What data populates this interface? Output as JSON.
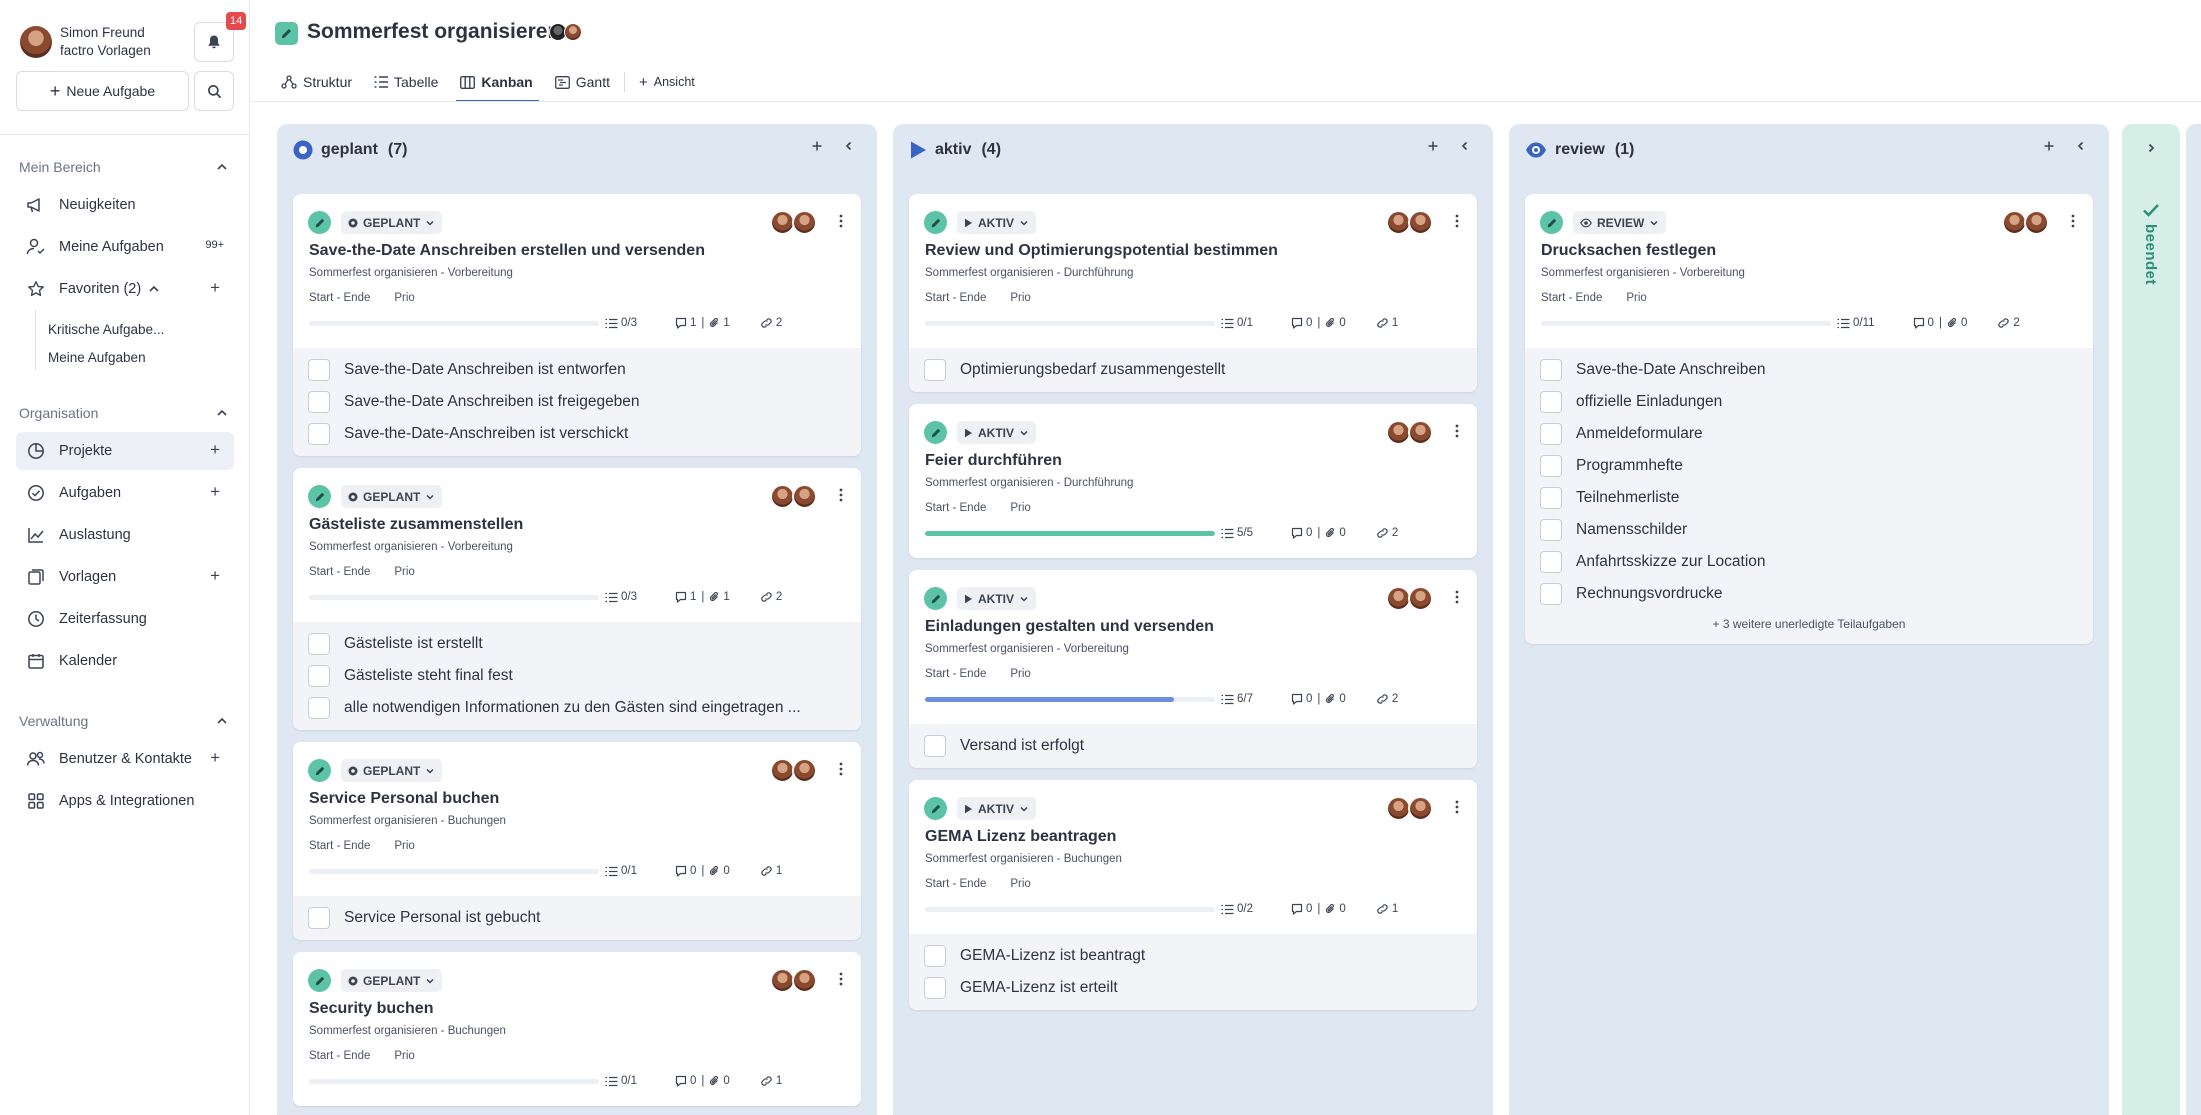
{
  "sidebar": {
    "user_name": "Simon Freund",
    "user_org": "factro Vorlagen",
    "notifications_count": "14",
    "new_task_label": "Neue Aufgabe",
    "sections": {
      "mein_bereich": "Mein Bereich",
      "organisation": "Organisation",
      "verwaltung": "Verwaltung"
    },
    "items": {
      "neuigkeiten": "Neuigkeiten",
      "meine_aufgaben": "Meine Aufgaben",
      "meine_aufgaben_badge": "99+",
      "favoriten": "Favoriten (2)",
      "fav_1": "Kritische Aufgabe...",
      "fav_2": "Meine Aufgaben",
      "projekte": "Projekte",
      "aufgaben": "Aufgaben",
      "auslastung": "Auslastung",
      "vorlagen": "Vorlagen",
      "zeiterfassung": "Zeiterfassung",
      "kalender": "Kalender",
      "benutzer": "Benutzer & Kontakte",
      "apps": "Apps & Integrationen"
    }
  },
  "header": {
    "title": "Sommerfest organisieren",
    "tabs": {
      "struktur": "Struktur",
      "tabelle": "Tabelle",
      "kanban": "Kanban",
      "gantt": "Gantt",
      "ansicht": "Ansicht"
    }
  },
  "colors": {
    "accent": "#3a63c6",
    "green": "#5cc3a7",
    "progress_green": "#5cc3a7",
    "progress_blue": "#6b8fdb",
    "column_bg": "#dfe7f3",
    "done_bg": "#d5efe6"
  },
  "columns": {
    "geplant": {
      "title": "geplant",
      "count": "(7)",
      "cards": [
        {
          "status": "GEPLANT",
          "title": "Save-the-Date Anschreiben erstellen und versenden",
          "subtitle": "Sommerfest organisieren - Vorbereitung",
          "dates": "Start - Ende",
          "prio": "Prio",
          "progress": 0,
          "checks": "0/3",
          "comments": "1",
          "attachments": "1",
          "links": "2",
          "subtasks": [
            "Save-the-Date Anschreiben ist entworfen",
            "Save-the-Date Anschreiben ist freigegeben",
            "Save-the-Date-Anschreiben ist verschickt"
          ]
        },
        {
          "status": "GEPLANT",
          "title": "Gästeliste zusammenstellen",
          "subtitle": "Sommerfest organisieren - Vorbereitung",
          "dates": "Start - Ende",
          "prio": "Prio",
          "progress": 0,
          "checks": "0/3",
          "comments": "1",
          "attachments": "1",
          "links": "2",
          "subtasks": [
            "Gästeliste ist erstellt",
            "Gästeliste steht final fest",
            "alle notwendigen Informationen zu den Gästen sind eingetragen ..."
          ]
        },
        {
          "status": "GEPLANT",
          "title": "Service Personal buchen",
          "subtitle": "Sommerfest organisieren - Buchungen",
          "dates": "Start - Ende",
          "prio": "Prio",
          "progress": 0,
          "checks": "0/1",
          "comments": "0",
          "attachments": "0",
          "links": "1",
          "subtasks": [
            "Service Personal ist gebucht"
          ]
        },
        {
          "status": "GEPLANT",
          "title": "Security buchen",
          "subtitle": "Sommerfest organisieren - Buchungen",
          "dates": "Start - Ende",
          "prio": "Prio",
          "progress": 0,
          "checks": "0/1",
          "comments": "0",
          "attachments": "0",
          "links": "1",
          "subtasks": []
        }
      ]
    },
    "aktiv": {
      "title": "aktiv",
      "count": "(4)",
      "cards": [
        {
          "status": "AKTIV",
          "title": "Review und Optimierungspotential bestimmen",
          "subtitle": "Sommerfest organisieren - Durchführung",
          "dates": "Start - Ende",
          "prio": "Prio",
          "progress": 0,
          "checks": "0/1",
          "comments": "0",
          "attachments": "0",
          "links": "1",
          "subtasks": [
            "Optimierungsbedarf zusammengestellt"
          ]
        },
        {
          "status": "AKTIV",
          "title": "Feier durchführen",
          "subtitle": "Sommerfest organisieren - Durchführung",
          "dates": "Start - Ende",
          "prio": "Prio",
          "progress": 1,
          "checks": "5/5",
          "comments": "0",
          "attachments": "0",
          "links": "2",
          "subtasks": []
        },
        {
          "status": "AKTIV",
          "title": "Einladungen gestalten und versenden",
          "subtitle": "Sommerfest organisieren - Vorbereitung",
          "dates": "Start - Ende",
          "prio": "Prio",
          "progress": 0.857,
          "checks": "6/7",
          "comments": "0",
          "attachments": "0",
          "links": "2",
          "subtasks": [
            "Versand ist erfolgt"
          ]
        },
        {
          "status": "AKTIV",
          "title": "GEMA Lizenz beantragen",
          "subtitle": "Sommerfest organisieren - Buchungen",
          "dates": "Start - Ende",
          "prio": "Prio",
          "progress": 0,
          "checks": "0/2",
          "comments": "0",
          "attachments": "0",
          "links": "1",
          "subtasks": [
            "GEMA-Lizenz ist beantragt",
            "GEMA-Lizenz ist erteilt"
          ]
        }
      ]
    },
    "review": {
      "title": "review",
      "count": "(1)",
      "cards": [
        {
          "status": "REVIEW",
          "title": "Drucksachen festlegen",
          "subtitle": "Sommerfest organisieren - Vorbereitung",
          "dates": "Start - Ende",
          "prio": "Prio",
          "progress": 0,
          "checks": "0/11",
          "comments": "0",
          "attachments": "0",
          "links": "2",
          "subtasks": [
            "Save-the-Date Anschreiben",
            "offizielle Einladungen",
            "Anmeldeformulare",
            "Programmhefte",
            "Teilnehmerliste",
            "Namensschilder",
            "Anfahrtsskizze zur Location",
            "Rechnungsvordrucke"
          ],
          "more": "+ 3 weitere unerledigte Teilaufgaben"
        }
      ]
    },
    "beendet": {
      "title": "beendet"
    }
  }
}
